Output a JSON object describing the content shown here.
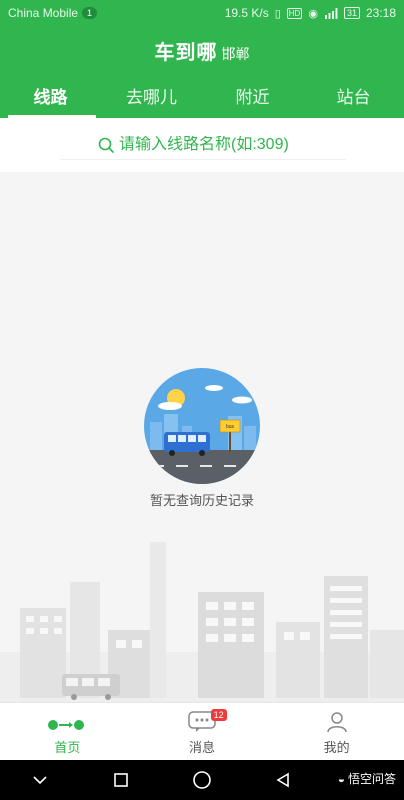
{
  "status_bar": {
    "carrier": "China Mobile",
    "sim_badge": "1",
    "net_speed": "19.5 K/s",
    "battery": "31",
    "time": "23:18",
    "icons": [
      "vibrate-icon",
      "hd-icon",
      "eye-icon",
      "signal-icon",
      "battery-icon"
    ]
  },
  "header": {
    "title": "车到哪",
    "city": "邯郸"
  },
  "tabs": [
    {
      "label": "线路",
      "active": true
    },
    {
      "label": "去哪儿",
      "active": false
    },
    {
      "label": "附近",
      "active": false
    },
    {
      "label": "站台",
      "active": false
    }
  ],
  "search": {
    "placeholder": "请输入线路名称(如:309)"
  },
  "empty_state": {
    "text": "暂无查询历史记录",
    "sign_text": "bus"
  },
  "bottom_nav": {
    "items": [
      {
        "label": "首页",
        "icon": "route-icon",
        "active": true
      },
      {
        "label": "消息",
        "icon": "message-icon",
        "badge": "12",
        "active": false
      },
      {
        "label": "我的",
        "icon": "profile-icon",
        "active": false
      }
    ]
  },
  "system_nav": {
    "buttons": [
      "collapse-icon",
      "recents-icon",
      "home-icon",
      "back-icon"
    ]
  },
  "watermark": {
    "text": "悟空问答"
  },
  "colors": {
    "primary": "#31b54f",
    "badge": "#ef3b3b",
    "background": "#f5f5f5"
  }
}
